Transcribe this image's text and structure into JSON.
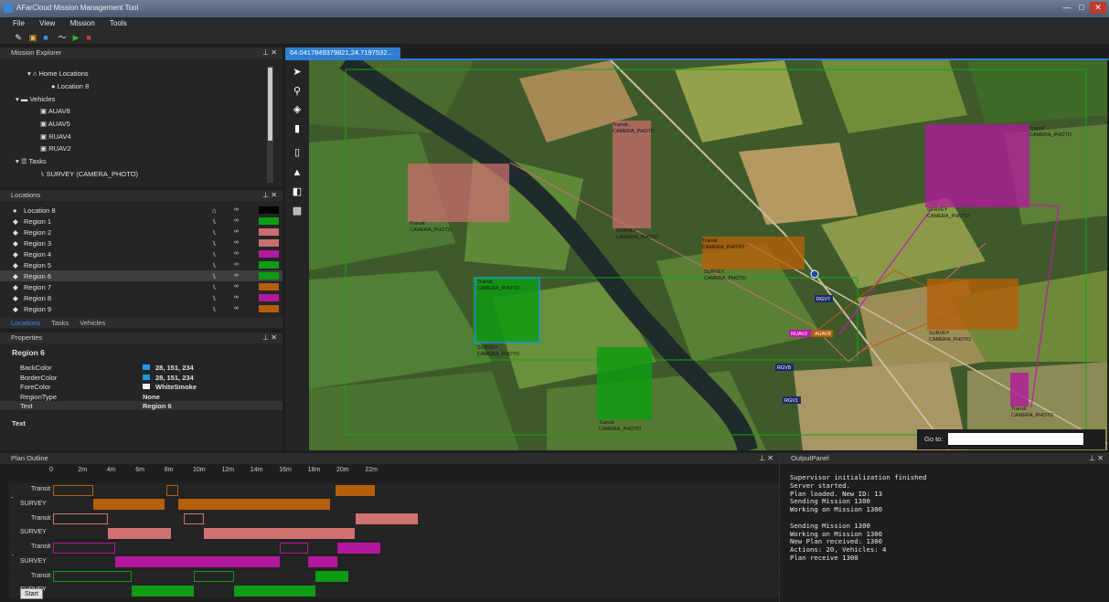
{
  "app": {
    "title": "AFarCloud Mission Management Tool",
    "min": "—",
    "max": "□",
    "close": "✕"
  },
  "menu": [
    "File",
    "View",
    "Mission",
    "Tools"
  ],
  "mission_explorer": {
    "title": "Mission Explorer",
    "home_locations": "Home Locations",
    "location": "Location 8",
    "vehicles_label": "Vehicles",
    "vehicles": [
      "AUAV8",
      "AUAV5",
      "RUAV4",
      "RUAV2"
    ],
    "tasks_label": "Tasks",
    "task": "SURVEY (CAMERA_PHOTO)"
  },
  "locations": {
    "title": "Locations",
    "items": [
      {
        "name": "Location 8",
        "color": "#000000"
      },
      {
        "name": "Region 1",
        "color": "#0e9c12"
      },
      {
        "name": "Region 2",
        "color": "#c96e6e"
      },
      {
        "name": "Region 3",
        "color": "#c96e6e"
      },
      {
        "name": "Region 4",
        "color": "#b3189e"
      },
      {
        "name": "Region 5",
        "color": "#0e9c12"
      },
      {
        "name": "Region 6",
        "color": "#0e9c12"
      },
      {
        "name": "Region 7",
        "color": "#b55f0a"
      },
      {
        "name": "Region 8",
        "color": "#b3189e"
      },
      {
        "name": "Region 9",
        "color": "#b55f0a"
      }
    ],
    "tabs": [
      "Locations",
      "Tasks",
      "Vehicles"
    ]
  },
  "properties": {
    "title": "Properties",
    "heading": "Region 6",
    "rows": [
      {
        "key": "BackColor",
        "value": "28, 151, 234",
        "swatch": "#1c97ea"
      },
      {
        "key": "BorderColor",
        "value": "28, 151, 234",
        "swatch": "#1c97ea"
      },
      {
        "key": "ForeColor",
        "value": "WhiteSmoke",
        "swatch": "#f5f5f5"
      },
      {
        "key": "RegionType",
        "value": "None",
        "swatch": ""
      },
      {
        "key": "Text",
        "value": "Region 6",
        "swatch": ""
      }
    ],
    "footer": "Text"
  },
  "map": {
    "tab": "64.0417849379821,24.7197532...",
    "tools": [
      "pointer-icon",
      "marker-icon",
      "layers-icon",
      "trash-icon",
      "map-icon",
      "terrain-icon",
      "satellite-icon",
      "image-icon"
    ],
    "labels": [
      "Transit",
      "CAMERA_PHOTO",
      "SURVEY"
    ],
    "vehicles": [
      "RGV7",
      "RUAV2",
      "AUAV8",
      "RGV8",
      "RGV1"
    ],
    "goto_label": "Go to:"
  },
  "plan": {
    "title": "Plan Outline",
    "ticks": [
      "0",
      "2m",
      "4m",
      "6m",
      "8m",
      "10m",
      "12m",
      "14m",
      "16m",
      "18m",
      "20m",
      "22m"
    ],
    "vehicles": [
      "AUAV8",
      "AUAV5",
      "RUAV4",
      "RUAV2"
    ],
    "row_labels": [
      "Transit",
      "SURVEY"
    ],
    "start_button": "Start",
    "colors": {
      "auav8": "#b55f0a",
      "auav5": "#d07272",
      "ruav4": "#b3189e",
      "ruav2": "#0e9c12"
    },
    "note": ""
  },
  "output": {
    "title": "OutputPanel",
    "lines": [
      "Supervisor initialization finished",
      "Server started.",
      "Plan loaded. New ID: 13",
      "Sending Mission 1300",
      "Working on Mission 1300",
      "",
      "Sending Mission 1300",
      "Working on Mission 1300",
      "New Plan received: 1300",
      "Actions: 20, Vehicles: 4",
      "Plan receive 1300"
    ]
  }
}
